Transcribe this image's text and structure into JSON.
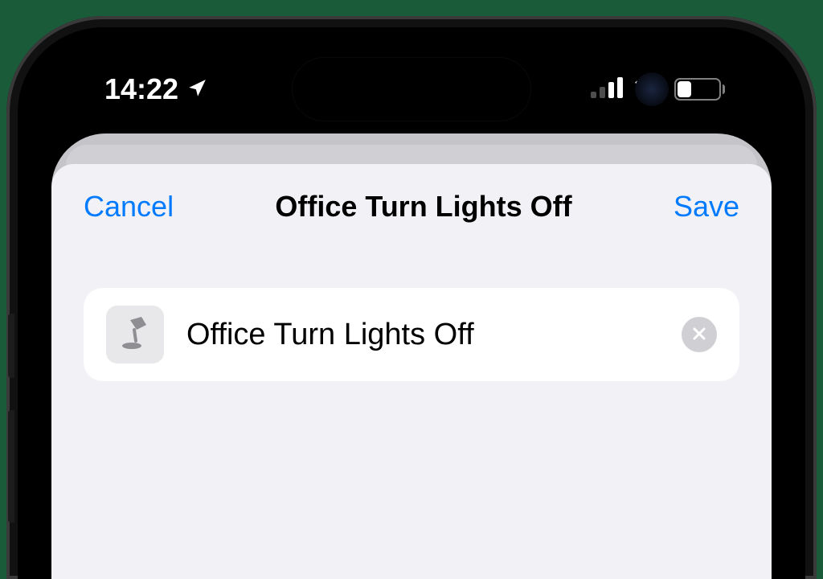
{
  "status_bar": {
    "time": "14:22",
    "battery_percent": "31"
  },
  "sheet": {
    "cancel_label": "Cancel",
    "title": "Office Turn Lights Off",
    "save_label": "Save",
    "name_field_value": "Office Turn Lights Off"
  },
  "colors": {
    "accent": "#007aff"
  }
}
